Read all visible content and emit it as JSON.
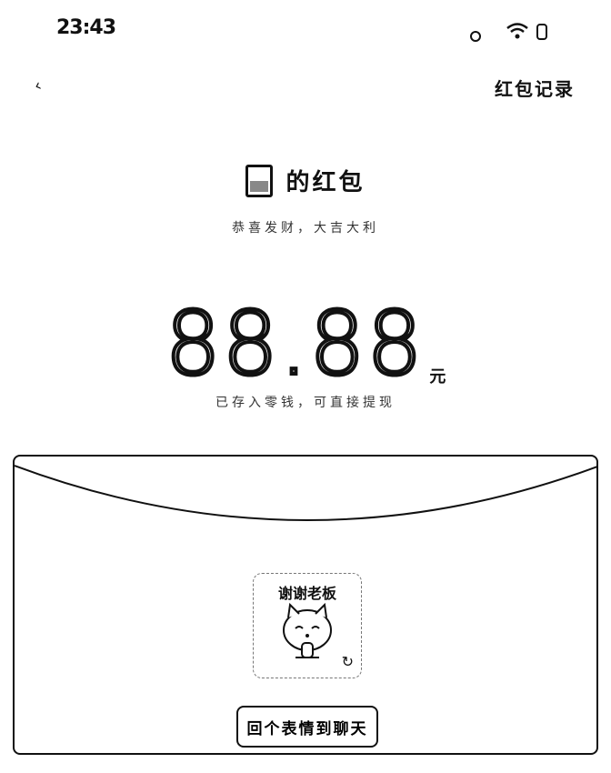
{
  "status_bar": {
    "time": "23:43",
    "icons": [
      "dot-icon",
      "wifi-icon",
      "battery-icon"
    ]
  },
  "nav": {
    "back_icon": "back-arrow-icon",
    "records_label": "红包记录"
  },
  "sender": {
    "name": "的红包",
    "greeting": "恭喜发财，大吉大利"
  },
  "amount": {
    "value": "88.88",
    "unit": "元",
    "note": "已存入零钱，可直接提现"
  },
  "sticker": {
    "caption": "谢谢老板",
    "icon": "cat-thanks-sticker-icon",
    "refresh_icon": "refresh-icon"
  },
  "action": {
    "label": "回个表情到聊天"
  }
}
